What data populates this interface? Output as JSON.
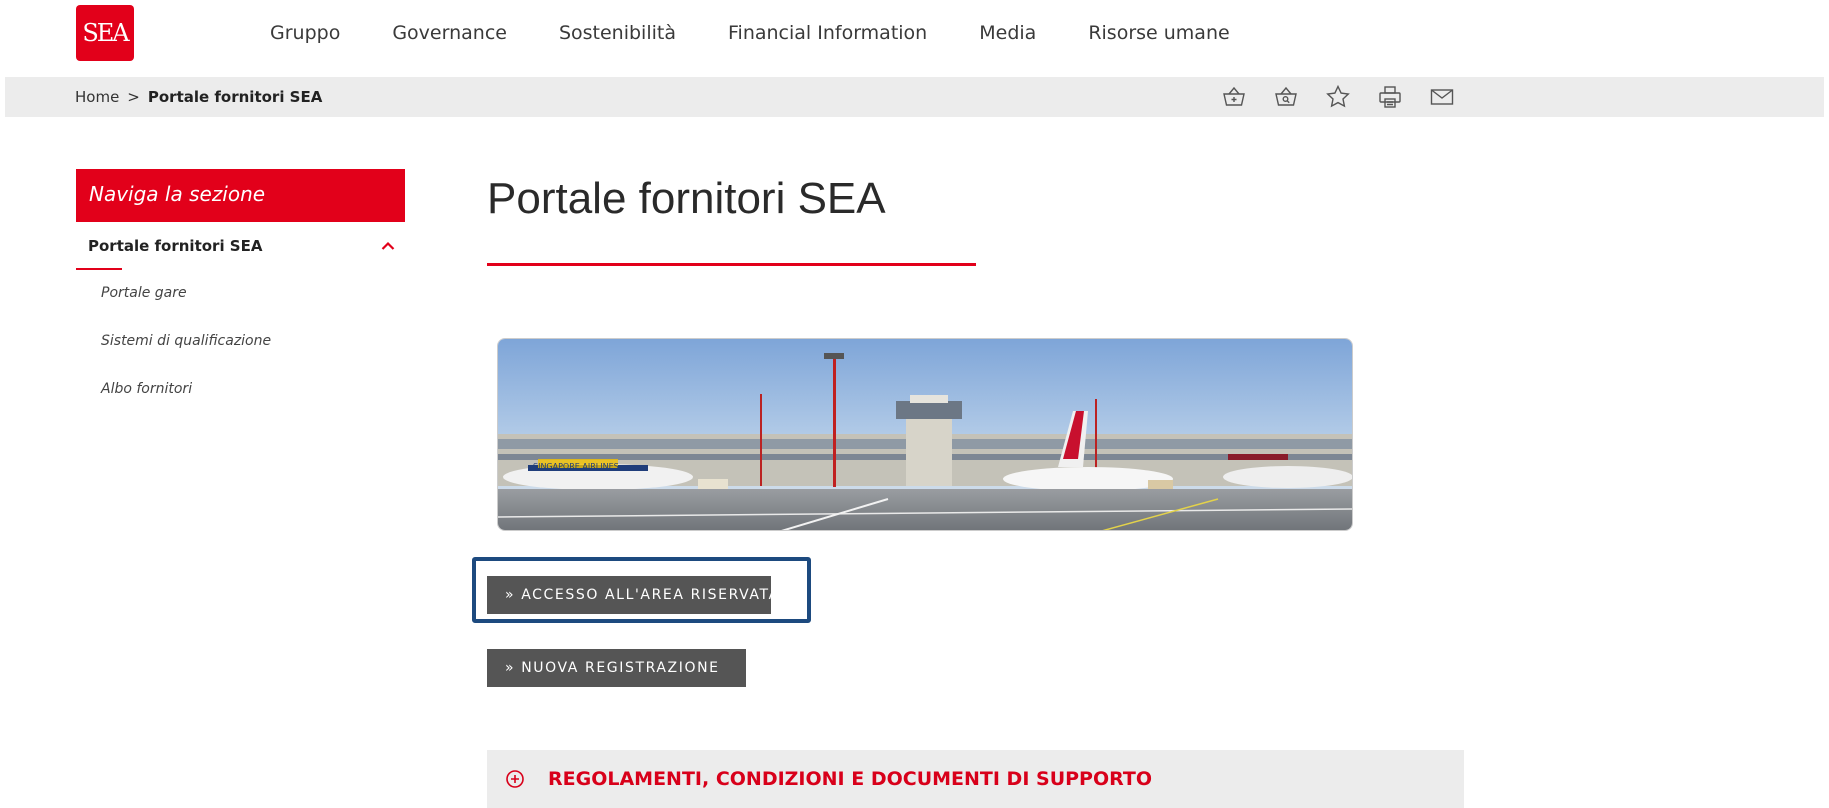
{
  "brand": {
    "logo_text": "SEA",
    "accent_color": "#e2001a"
  },
  "nav": {
    "items": [
      "Gruppo",
      "Governance",
      "Sostenibilità",
      "Financial Information",
      "Media",
      "Risorse umane"
    ]
  },
  "breadcrumb": {
    "home": "Home",
    "separator": ">",
    "current": "Portale fornitori SEA"
  },
  "toolbar": {
    "icons": [
      "basket-add-icon",
      "basket-search-icon",
      "star-icon",
      "print-icon",
      "mail-icon"
    ]
  },
  "sidebar": {
    "heading": "Naviga la sezione",
    "section": "Portale fornitori SEA",
    "links": [
      "Portale gare",
      "Sistemi di qualificazione",
      "Albo fornitori"
    ]
  },
  "main": {
    "title": "Portale fornitori SEA",
    "buttons": {
      "access": "» ACCESSO ALL'AREA RISERVATA",
      "register": "» NUOVA REGISTRAZIONE"
    },
    "accordion": "REGOLAMENTI, CONDIZIONI E DOCUMENTI DI SUPPORTO",
    "hero_text": "SINGAPORE AIRLINES"
  }
}
